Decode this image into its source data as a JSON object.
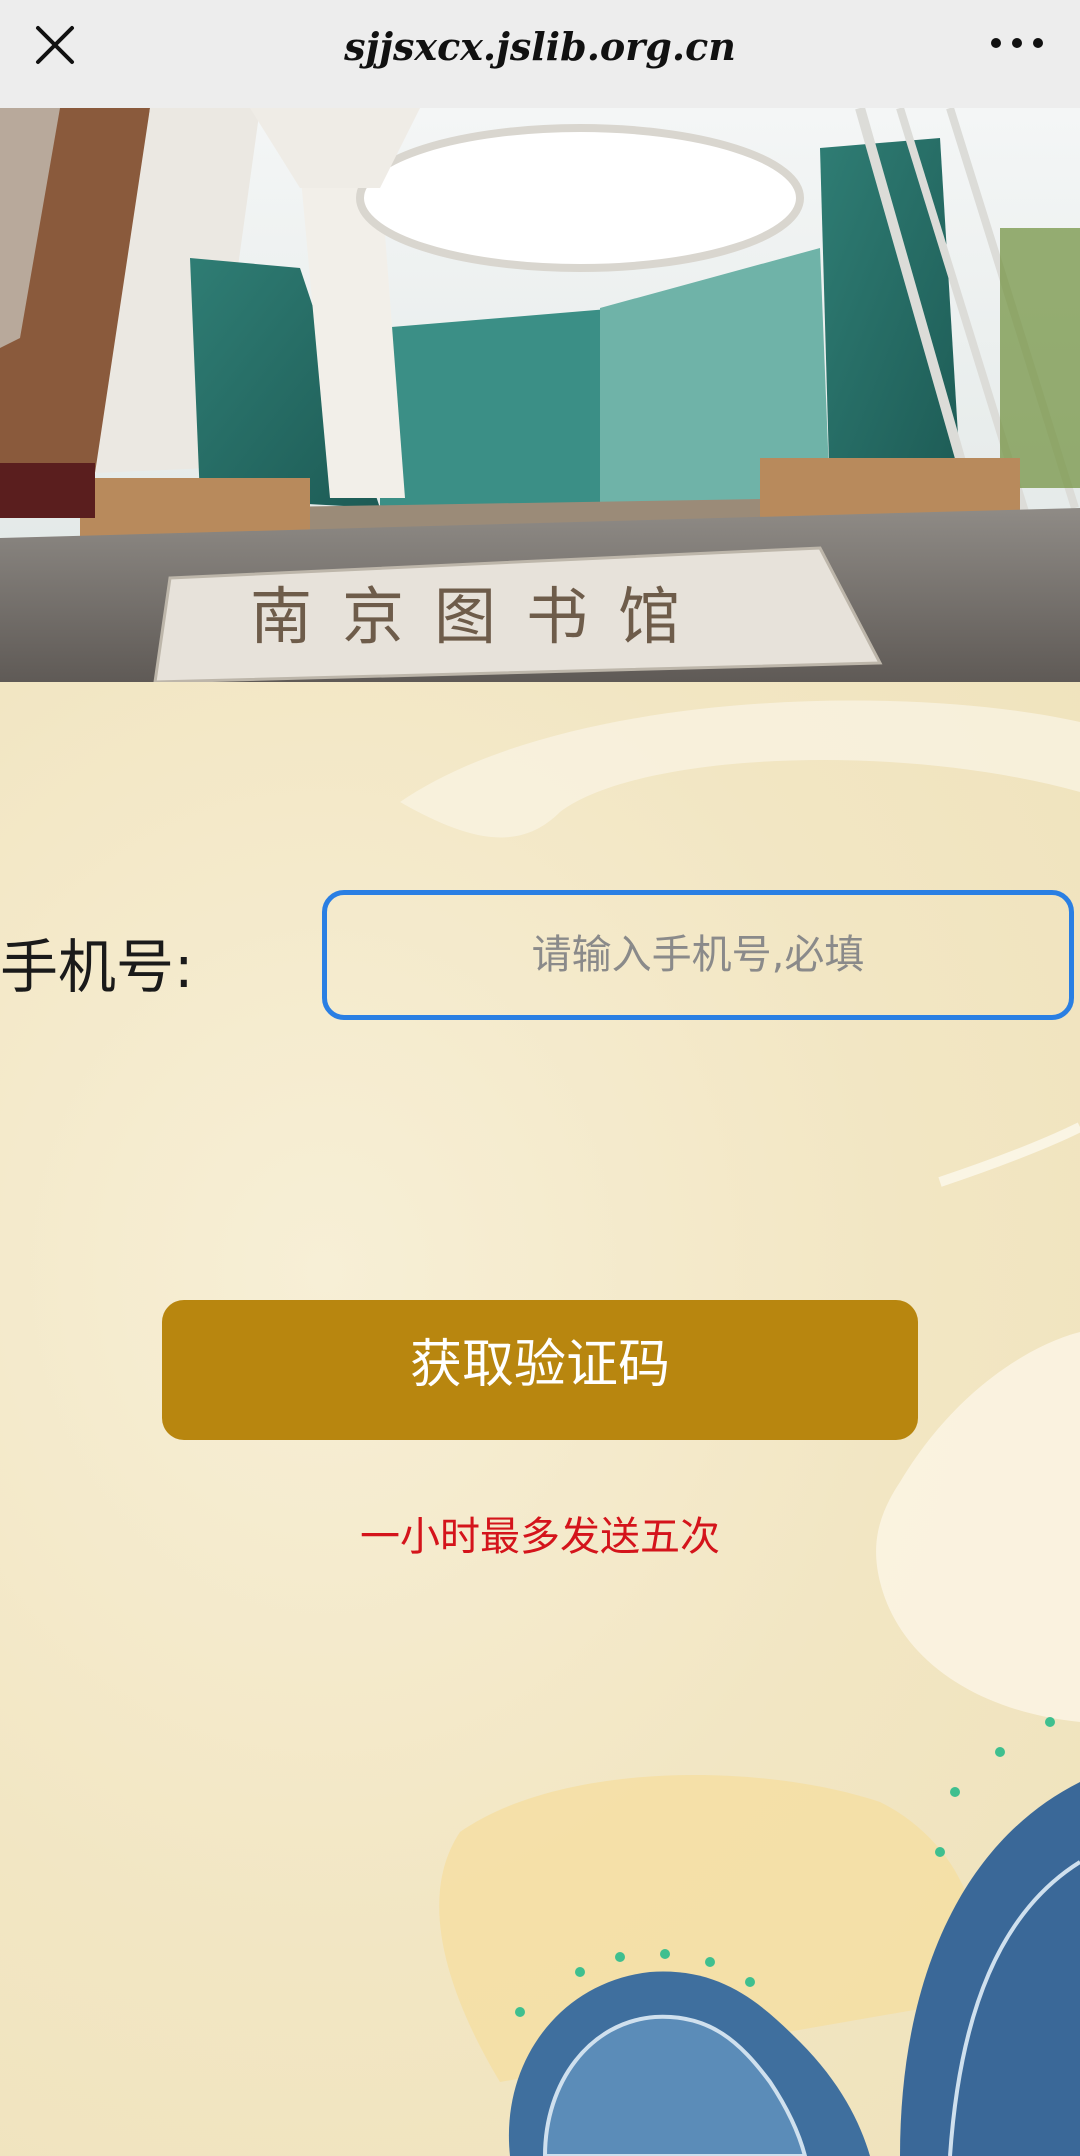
{
  "browser": {
    "title": "sjjsxcx.jslib.org.cn",
    "close_icon": "close-icon",
    "more_icon": "more-icon"
  },
  "hero": {
    "sign_text": "南京图书馆"
  },
  "form": {
    "phone_label": "手机号:",
    "phone_value": "",
    "phone_placeholder": "请输入手机号,必填",
    "get_code_label": "获取验证码",
    "limit_note": "一小时最多发送五次"
  },
  "colors": {
    "accent_border": "#2a7fe3",
    "button": "#b8860f",
    "warning_text": "#d4141b",
    "background": "#f3e9c9"
  }
}
